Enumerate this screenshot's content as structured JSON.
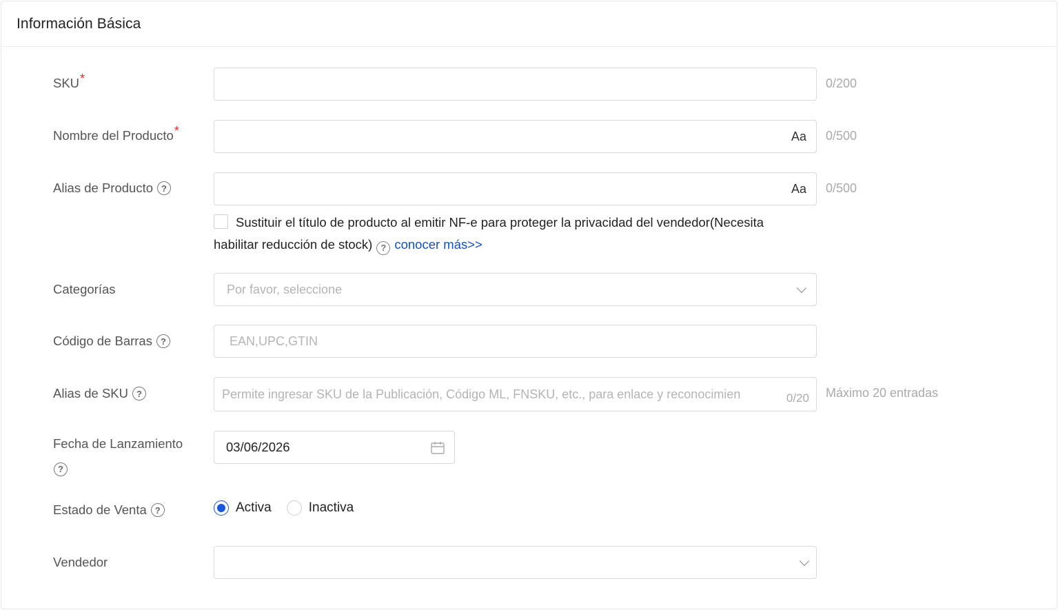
{
  "section": {
    "title": "Información Básica"
  },
  "fields": {
    "sku": {
      "label": "SKU",
      "required_mark": "*",
      "value": "",
      "counter": "0/200"
    },
    "product_name": {
      "label": "Nombre del Producto",
      "required_mark": "*",
      "value": "",
      "case_toggle": "Aa",
      "counter": "0/500"
    },
    "product_alias": {
      "label": "Alias de Producto",
      "value": "",
      "case_toggle": "Aa",
      "counter": "0/500",
      "checkbox_text": "Sustituir el título de producto al emitir NF-e para proteger la privacidad del vendedor(Necesita habilitar reducción de stock)",
      "learn_more": "conocer más>>"
    },
    "categories": {
      "label": "Categorías",
      "placeholder": "Por favor, seleccione"
    },
    "barcode": {
      "label": "Código de Barras",
      "placeholder": "EAN,UPC,GTIN"
    },
    "sku_alias": {
      "label": "Alias de SKU",
      "placeholder": "Permite ingresar SKU de la Publicación, Código ML, FNSKU, etc., para enlace y reconocimien",
      "counter": "0/20",
      "note": "Máximo 20 entradas"
    },
    "launch_date": {
      "label": "Fecha de Lanzamiento",
      "value": "03/06/2026"
    },
    "sale_status": {
      "label": "Estado de Venta",
      "options": [
        "Activa",
        "Inactiva"
      ],
      "selected": "Activa"
    },
    "seller": {
      "label": "Vendedor",
      "value": ""
    }
  },
  "icons": {
    "help": "question-circle-icon",
    "calendar": "calendar-icon",
    "dropdown": "chevron-down-icon"
  },
  "colors": {
    "required": "#f5222d",
    "link": "#1450c8",
    "radio_active": "#1a56db"
  }
}
